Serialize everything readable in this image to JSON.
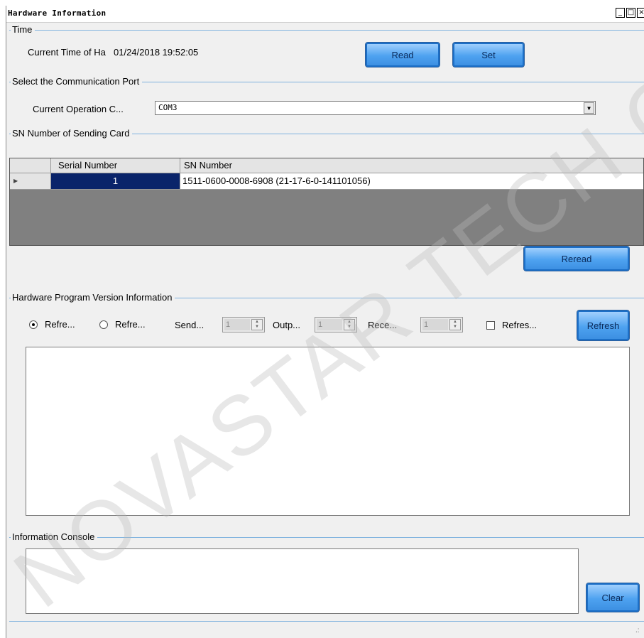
{
  "window": {
    "title": "Hardware Information",
    "minimize": "_",
    "maximize": "□",
    "close": "×"
  },
  "time_group": {
    "legend": "Time",
    "current_time_label": "Current Time of Ha",
    "current_time_value": "01/24/2018 19:52:05",
    "read_label": "Read",
    "set_label": "Set"
  },
  "port_group": {
    "legend": "Select the Communication Port",
    "operation_label": "Current Operation C...",
    "selected_port": "COM3"
  },
  "sn_group": {
    "legend": "SN Number of Sending Card",
    "columns": [
      "Serial Number",
      "SN Number"
    ],
    "rows": [
      {
        "serial": "1",
        "sn": "1511-0600-0008-6908  (21-17-6-0-141101056)"
      }
    ],
    "reread_label": "Reread"
  },
  "hw_group": {
    "legend": "Hardware Program Version Information",
    "radio1_label": "Refre...",
    "radio2_label": "Refre...",
    "send_label": "Send...",
    "send_value": "1",
    "output_label": "Outp...",
    "output_value": "1",
    "receive_label": "Rece...",
    "receive_value": "1",
    "refresh_check_label": "Refres...",
    "refresh_button": "Refresh"
  },
  "console_group": {
    "legend": "Information Console",
    "clear_label": "Clear"
  },
  "watermark": "NOVASTAR TECH CO., LT",
  "colors": {
    "group_line": "#7fb2de",
    "button_blue": "#4ea2f0",
    "selected_cell": "#0a246a"
  }
}
